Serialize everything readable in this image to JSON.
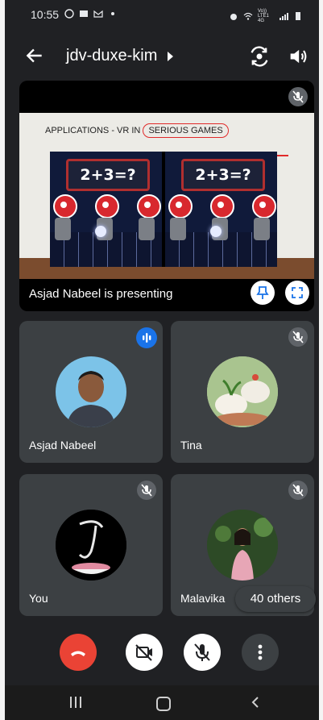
{
  "status_bar": {
    "time": "10:55",
    "network": "Vo)) LTE1 4G"
  },
  "header": {
    "meeting_code": "jdv-duxe-kim"
  },
  "presentation": {
    "slide_title_prefix": "APPLICATIONS - VR IN ",
    "slide_title_highlight": "SERIOUS GAMES",
    "equation": "2+3=?",
    "presenter_label": "Asjad Nabeel is presenting"
  },
  "participants": [
    {
      "name": "Asjad Nabeel",
      "speaking": true
    },
    {
      "name": "Tina",
      "muted": true
    },
    {
      "name": "You",
      "muted": true
    },
    {
      "name": "Malavika",
      "muted": true
    }
  ],
  "others_badge": "40 others",
  "colors": {
    "end_call": "#ea4335",
    "speaking": "#1a73e8",
    "tile_bg": "#3c4043",
    "app_bg": "#202124"
  }
}
